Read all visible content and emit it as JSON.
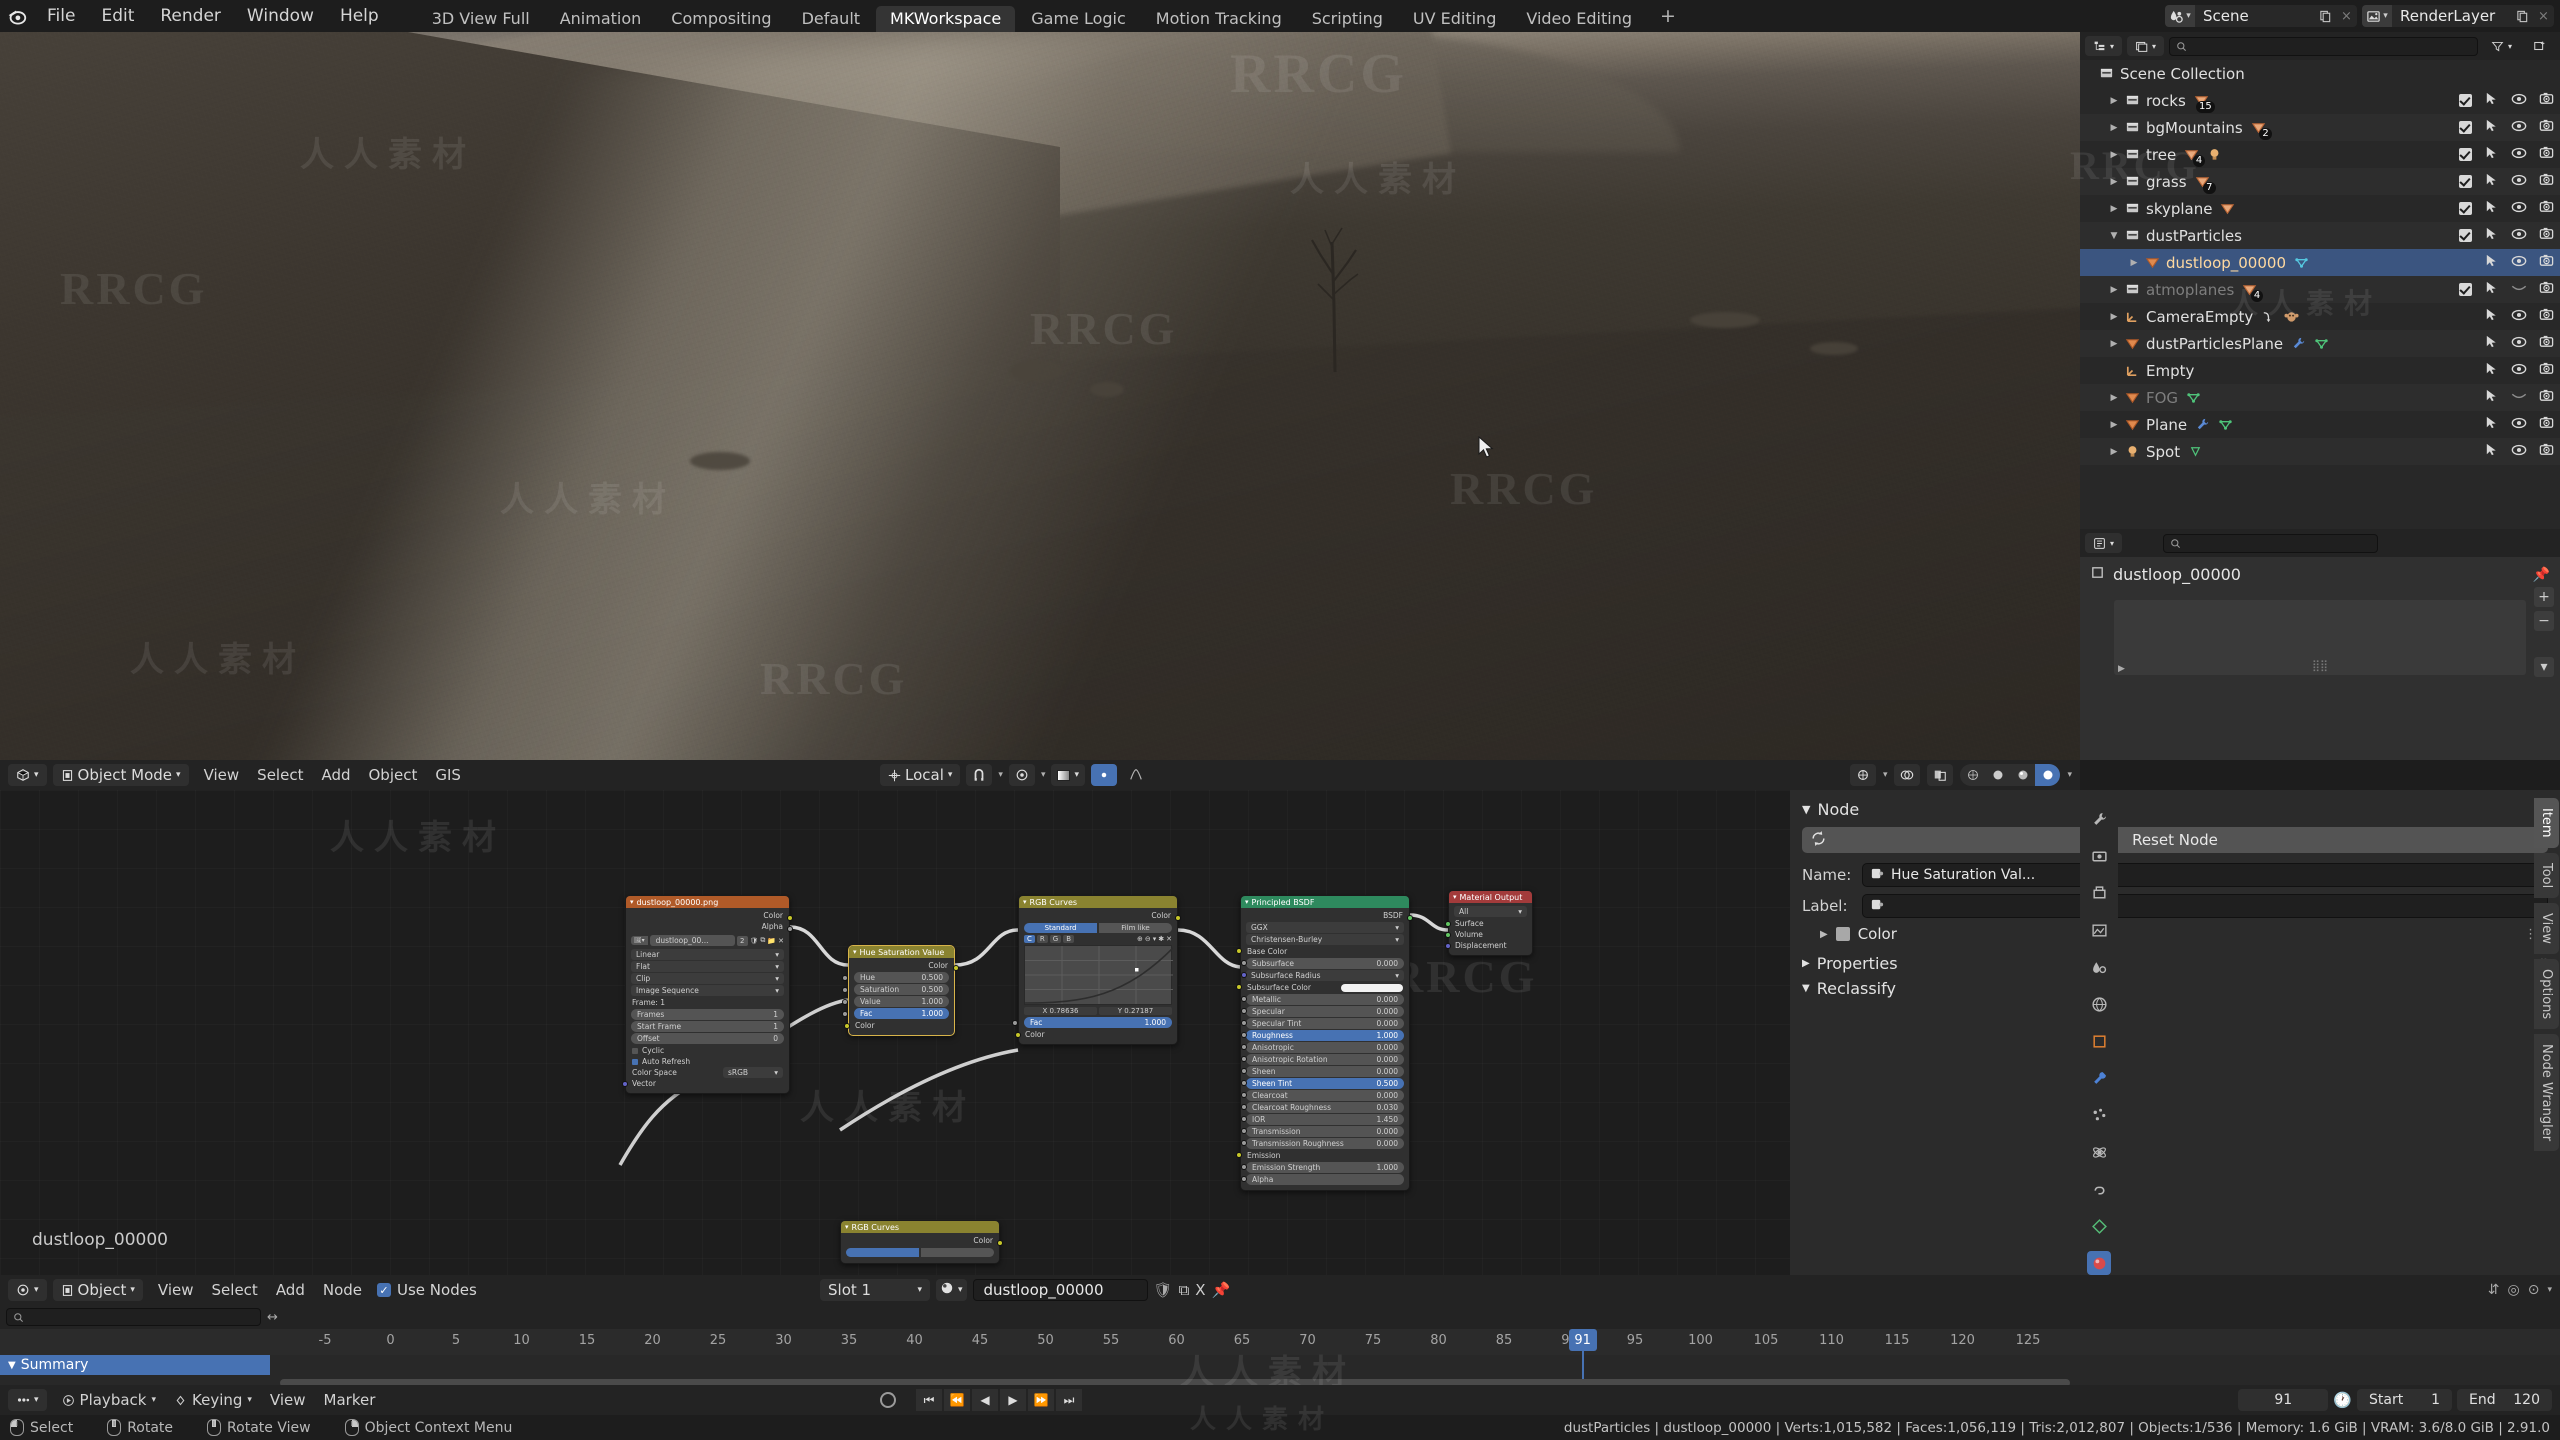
{
  "app": {
    "version": "2.91.0"
  },
  "topbar": {
    "logo_icon": "blender-logo-icon",
    "menus": [
      "File",
      "Edit",
      "Render",
      "Window",
      "Help"
    ],
    "workspaces": [
      {
        "label": "3D View Full",
        "active": false
      },
      {
        "label": "Animation",
        "active": false
      },
      {
        "label": "Compositing",
        "active": false
      },
      {
        "label": "Default",
        "active": false
      },
      {
        "label": "MKWorkspace",
        "active": true
      },
      {
        "label": "Game Logic",
        "active": false
      },
      {
        "label": "Motion Tracking",
        "active": false
      },
      {
        "label": "Scripting",
        "active": false
      },
      {
        "label": "UV Editing",
        "active": false
      },
      {
        "label": "Video Editing",
        "active": false
      }
    ],
    "add_workspace": "+",
    "scene": {
      "icon": "scene-icon",
      "name": "Scene",
      "new_btn": "new-scene-icon",
      "unlink_btn": "×"
    },
    "viewlayer": {
      "icon": "viewlayer-icon",
      "name": "RenderLayer",
      "new_btn": "new-viewlayer-icon",
      "unlink_btn": "×"
    }
  },
  "viewport": {
    "header": {
      "editor_type_icon": "editor-type-3dview-icon",
      "mode": "Object Mode",
      "menus": [
        "View",
        "Select",
        "Add",
        "Object",
        "GIS"
      ],
      "transform_orientation": "Local",
      "snap_icon": "magnet-icon",
      "proportional_icon": "proportional-edit-icon",
      "overlay_icon": "overlays-icon",
      "xray_icon": "xray-icon",
      "gizmo_icon": "gizmo-icon",
      "shading_modes": [
        "wireframe",
        "solid",
        "material-preview",
        "rendered"
      ],
      "shading_active": "rendered"
    }
  },
  "outliner": {
    "display_mode_icon": "outliner-display-mode-icon",
    "filter_id_icon": "blender-file-icon",
    "search_placeholder": "",
    "filter_icon": "funnel-icon",
    "new_collection_icon": "new-collection-icon",
    "root": {
      "label": "Scene Collection",
      "icon": "collection-icon"
    },
    "items": [
      {
        "label": "rocks",
        "icon": "collection-icon",
        "indent": 1,
        "expandable": true,
        "expanded": false,
        "badges": [
          {
            "icon": "mesh-data-icon",
            "count": "15"
          }
        ],
        "checkbox": true,
        "selectable": true,
        "visible": true,
        "camera": true,
        "dim": false,
        "selected": false
      },
      {
        "label": "bgMountains",
        "icon": "collection-icon",
        "indent": 1,
        "expandable": true,
        "expanded": false,
        "badges": [
          {
            "icon": "mesh-data-icon",
            "count": "2"
          }
        ],
        "checkbox": true,
        "selectable": true,
        "visible": true,
        "camera": true,
        "dim": false,
        "selected": false
      },
      {
        "label": "tree",
        "icon": "collection-icon",
        "indent": 1,
        "expandable": true,
        "expanded": false,
        "badges": [
          {
            "icon": "mesh-data-icon",
            "count": "4"
          },
          {
            "icon": "light-data-icon",
            "count": ""
          }
        ],
        "checkbox": true,
        "selectable": true,
        "visible": true,
        "camera": true,
        "dim": false,
        "selected": false
      },
      {
        "label": "grass",
        "icon": "collection-icon",
        "indent": 1,
        "expandable": true,
        "expanded": false,
        "badges": [
          {
            "icon": "mesh-data-icon",
            "count": "7"
          }
        ],
        "checkbox": true,
        "selectable": true,
        "visible": true,
        "camera": true,
        "dim": false,
        "selected": false
      },
      {
        "label": "skyplane",
        "icon": "collection-icon",
        "indent": 1,
        "expandable": true,
        "expanded": false,
        "badges": [
          {
            "icon": "mesh-data-icon",
            "count": ""
          }
        ],
        "checkbox": true,
        "selectable": true,
        "visible": true,
        "camera": true,
        "dim": false,
        "selected": false
      },
      {
        "label": "dustParticles",
        "icon": "collection-icon",
        "indent": 1,
        "expandable": true,
        "expanded": true,
        "badges": [],
        "checkbox": true,
        "selectable": true,
        "visible": true,
        "camera": true,
        "dim": false,
        "selected": false
      },
      {
        "label": "dustloop_00000",
        "icon": "mesh-object-icon",
        "indent": 2,
        "expandable": true,
        "expanded": false,
        "badges": [
          {
            "icon": "mesh-data-cyan-icon",
            "count": ""
          }
        ],
        "checkbox": false,
        "selectable": true,
        "visible": true,
        "camera": true,
        "dim": false,
        "selected": true
      },
      {
        "label": "atmoplanes",
        "icon": "collection-icon",
        "indent": 1,
        "expandable": true,
        "expanded": false,
        "badges": [
          {
            "icon": "mesh-data-icon",
            "count": "4"
          }
        ],
        "checkbox": true,
        "selectable": true,
        "visible": false,
        "camera": true,
        "dim": true,
        "selected": false
      },
      {
        "label": "CameraEmpty",
        "icon": "empty-axes-icon",
        "indent": 1,
        "expandable": true,
        "expanded": false,
        "badges": [
          {
            "icon": "constraint-icon",
            "count": ""
          },
          {
            "icon": "monkey-icon",
            "count": ""
          }
        ],
        "checkbox": false,
        "selectable": true,
        "visible": true,
        "camera": true,
        "dim": false,
        "selected": false
      },
      {
        "label": "dustParticlesPlane",
        "icon": "mesh-object-icon",
        "indent": 1,
        "expandable": true,
        "expanded": false,
        "badges": [
          {
            "icon": "modifier-wrench-icon",
            "count": ""
          },
          {
            "icon": "mesh-data-green-icon",
            "count": ""
          }
        ],
        "checkbox": false,
        "selectable": true,
        "visible": true,
        "camera": true,
        "dim": false,
        "selected": false
      },
      {
        "label": "Empty",
        "icon": "empty-axes-icon",
        "indent": 1,
        "expandable": false,
        "expanded": false,
        "badges": [],
        "checkbox": false,
        "selectable": true,
        "visible": true,
        "camera": true,
        "dim": false,
        "selected": false
      },
      {
        "label": "FOG",
        "icon": "mesh-object-icon",
        "indent": 1,
        "expandable": true,
        "expanded": false,
        "badges": [
          {
            "icon": "mesh-data-green-icon",
            "count": ""
          }
        ],
        "checkbox": false,
        "selectable": true,
        "visible": false,
        "camera": true,
        "dim": true,
        "selected": false
      },
      {
        "label": "Plane",
        "icon": "mesh-object-icon",
        "indent": 1,
        "expandable": true,
        "expanded": false,
        "badges": [
          {
            "icon": "modifier-wrench-icon",
            "count": ""
          },
          {
            "icon": "mesh-data-green-icon",
            "count": ""
          }
        ],
        "checkbox": false,
        "selectable": true,
        "visible": true,
        "camera": true,
        "dim": false,
        "selected": false
      },
      {
        "label": "Spot",
        "icon": "light-object-icon",
        "indent": 1,
        "expandable": true,
        "expanded": false,
        "badges": [
          {
            "icon": "light-data-green-icon",
            "count": ""
          }
        ],
        "checkbox": false,
        "selectable": true,
        "visible": true,
        "camera": true,
        "dim": false,
        "selected": false
      }
    ]
  },
  "properties": {
    "editor_icon": "properties-editor-icon",
    "search_placeholder": "",
    "object_name": "dustloop_00000",
    "pin_icon": "pin-icon",
    "tabs": [
      "tool-icon",
      "render-icon",
      "output-icon",
      "viewlayer-icon",
      "scene-icon",
      "world-icon",
      "object-icon",
      "modifier-icon",
      "particles-icon",
      "physics-icon",
      "constraints-icon",
      "data-icon",
      "material-icon"
    ],
    "active_tab": "material-icon"
  },
  "node_editor": {
    "breadcrumb": "dustloop_00000",
    "header": {
      "editor_type_icon": "editor-type-shader-icon",
      "shader_type": "Object",
      "menus": [
        "View",
        "Select",
        "Add",
        "Node"
      ],
      "use_nodes_label": "Use Nodes",
      "use_nodes_checked": true,
      "slot": "Slot 1",
      "material_icon": "material-sphere-icon",
      "material_name": "dustloop_00000",
      "fake_user_icon": "shield-icon",
      "copy_icon": "duplicate-icon",
      "unlink_label": "X",
      "pin_icon": "pin-icon"
    },
    "nodes": [
      {
        "id": "image-texture",
        "title": "dustloop_00000.png",
        "header_color": "#b05a28",
        "outputs": [
          "Color",
          "Alpha"
        ],
        "image_datablock": "dustloop_00...",
        "image_users": "2",
        "dropdowns": [
          "Linear",
          "Flat",
          "Clip",
          "Image Sequence"
        ],
        "frame_label": "Frame: 1",
        "fields": [
          {
            "label": "Frames",
            "value": "1"
          },
          {
            "label": "Start Frame",
            "value": "1"
          },
          {
            "label": "Offset",
            "value": "0"
          }
        ],
        "checks": [
          {
            "label": "Cyclic",
            "checked": false
          },
          {
            "label": "Auto Refresh",
            "checked": true
          }
        ],
        "colorspace_label": "Color Space",
        "colorspace_value": "sRGB",
        "input": "Vector"
      },
      {
        "id": "hue-saturation-value",
        "title": "Hue Saturation Value",
        "header_color": "#8a8330",
        "outputs": [
          "Color"
        ],
        "fields": [
          {
            "label": "Hue",
            "value": "0.500",
            "highlight": false
          },
          {
            "label": "Saturation",
            "value": "0.500",
            "highlight": false
          },
          {
            "label": "Value",
            "value": "1.000",
            "highlight": false
          },
          {
            "label": "Fac",
            "value": "1.000",
            "highlight": true
          }
        ],
        "input": "Color"
      },
      {
        "id": "rgb-curves-top",
        "title": "RGB Curves",
        "header_color": "#8a8330",
        "outputs": [
          "Color"
        ],
        "presets": [
          "Standard",
          "Film like"
        ],
        "preset_active": "Standard",
        "channels": [
          "C",
          "R",
          "G",
          "B"
        ],
        "channel_active": "C",
        "tool_icons": [
          "zoom-in-icon",
          "zoom-out-icon",
          "chevron-down-icon",
          "tools-icon",
          "delete-icon"
        ],
        "point_x": "X 0.78636",
        "point_y": "Y 0.27187",
        "fac_label": "Fac",
        "fac_value": "1.000",
        "input": "Color"
      },
      {
        "id": "principled-bsdf",
        "title": "Principled BSDF",
        "header_color": "#2e8a5e",
        "outputs": [
          "BSDF"
        ],
        "dropdowns": [
          "GGX",
          "Christensen-Burley"
        ],
        "sockets": [
          {
            "label": "Base Color",
            "value": "",
            "type": "color",
            "highlight": false
          },
          {
            "label": "Subsurface",
            "value": "0.000",
            "type": "num",
            "highlight": false
          },
          {
            "label": "Subsurface Radius",
            "value": "",
            "type": "drop",
            "highlight": false
          },
          {
            "label": "Subsurface Color",
            "value": "",
            "type": "swatch",
            "highlight": false
          },
          {
            "label": "Metallic",
            "value": "0.000",
            "type": "num",
            "highlight": false
          },
          {
            "label": "Specular",
            "value": "0.000",
            "type": "num",
            "highlight": false
          },
          {
            "label": "Specular Tint",
            "value": "0.000",
            "type": "num",
            "highlight": false
          },
          {
            "label": "Roughness",
            "value": "1.000",
            "type": "num",
            "highlight": true
          },
          {
            "label": "Anisotropic",
            "value": "0.000",
            "type": "num",
            "highlight": false
          },
          {
            "label": "Anisotropic Rotation",
            "value": "0.000",
            "type": "num",
            "highlight": false
          },
          {
            "label": "Sheen",
            "value": "0.000",
            "type": "num",
            "highlight": false
          },
          {
            "label": "Sheen Tint",
            "value": "0.500",
            "type": "num",
            "highlight": true
          },
          {
            "label": "Clearcoat",
            "value": "0.000",
            "type": "num",
            "highlight": false
          },
          {
            "label": "Clearcoat Roughness",
            "value": "0.030",
            "type": "num",
            "highlight": false
          },
          {
            "label": "IOR",
            "value": "1.450",
            "type": "num",
            "highlight": false
          },
          {
            "label": "Transmission",
            "value": "0.000",
            "type": "num",
            "highlight": false
          },
          {
            "label": "Transmission Roughness",
            "value": "0.000",
            "type": "num",
            "highlight": false
          },
          {
            "label": "Emission",
            "value": "",
            "type": "color",
            "highlight": false
          },
          {
            "label": "Emission Strength",
            "value": "1.000",
            "type": "num",
            "highlight": false
          },
          {
            "label": "Alpha",
            "value": "",
            "type": "num",
            "highlight": false
          }
        ]
      },
      {
        "id": "material-output",
        "title": "Material Output",
        "header_color": "#a33b3b",
        "dropdown": "All",
        "inputs": [
          "Surface",
          "Volume",
          "Displacement"
        ]
      },
      {
        "id": "rgb-curves-bottom",
        "title": "RGB Curves",
        "header_color": "#8a8330",
        "outputs": [
          "Color"
        ]
      }
    ],
    "sidebar": {
      "tabs": [
        "Item",
        "Tool",
        "View",
        "Options",
        "Node Wrangler"
      ],
      "active_tab": "Item",
      "panel_node": "Node",
      "reset_node_label": "Reset Node",
      "reset_icon": "refresh-icon",
      "name_label": "Name:",
      "name_value": "Hue Saturation Val...",
      "label_label": "Label:",
      "label_value": "",
      "color_label": "Color",
      "panel_properties": "Properties",
      "panel_reclassify": "Reclassify"
    }
  },
  "timeline": {
    "editor_type_icon": "editor-type-dopesheet-icon",
    "mode": "Object",
    "menus": [
      "View",
      "Select",
      "Add",
      "Node"
    ],
    "search_placeholder": "",
    "summary_label": "Summary",
    "ticks": [
      "-5",
      "0",
      "5",
      "10",
      "15",
      "20",
      "25",
      "30",
      "35",
      "40",
      "45",
      "50",
      "55",
      "60",
      "65",
      "70",
      "75",
      "80",
      "85",
      "90",
      "95",
      "100",
      "105",
      "110",
      "115",
      "120",
      "125"
    ],
    "current_frame": "91",
    "playback_menu": "Playback",
    "keying_menu": "Keying",
    "view_menu": "View",
    "marker_menu": "Marker",
    "frame_field": "91",
    "start_label": "Start",
    "start_value": "1",
    "end_label": "End",
    "end_value": "120"
  },
  "statusbar": {
    "hints": [
      {
        "mouse": "l",
        "label": "Select"
      },
      {
        "mouse": "m",
        "label": "Rotate"
      },
      {
        "mouse": "m",
        "label": "Rotate View"
      },
      {
        "mouse": "r",
        "label": "Object Context Menu"
      }
    ],
    "stats": "dustParticles | dustloop_00000 | Verts:1,015,582 | Faces:1,056,119 | Tris:2,012,807 | Objects:1/536 | Memory: 1.6 GiB | VRAM: 3.6/8.0 GiB | 2.91.0"
  },
  "watermarks": {
    "rrcg": "RRCG",
    "cn": "人人素材"
  }
}
